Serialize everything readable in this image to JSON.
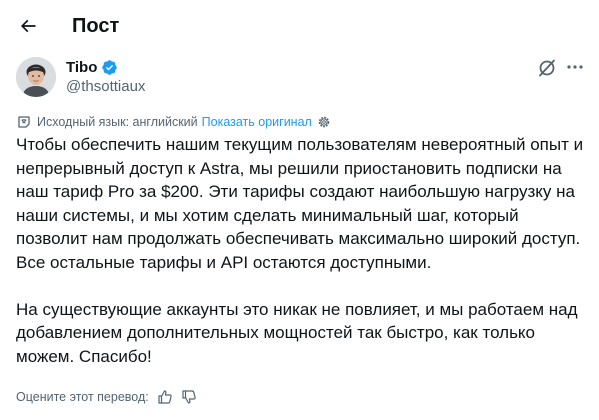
{
  "header": {
    "title": "Пост"
  },
  "author": {
    "name": "Tibo",
    "handle": "@thsottiaux",
    "verified": true
  },
  "translation": {
    "source_label": "Исходный язык: английский",
    "show_original": "Показать оригинал"
  },
  "post": {
    "paragraphs": [
      "Чтобы обеспечить нашим текущим пользователям невероятный опыт и непрерывный доступ к Astra, мы решили приостановить подписки на наш тариф Pro за $200. Эти тарифы создают наибольшую нагрузку на наши системы, и мы хотим сделать минимальный шаг, который позволит нам продолжать обеспечивать максимально широкий доступ. Все остальные тарифы и API остаются доступными.",
      "На существующие аккаунты это никак не повлияет, и мы работаем над добавлением дополнительных мощностей так быстро, как только можем. Спасибо!"
    ]
  },
  "rating": {
    "label": "Оцените этот перевод:"
  },
  "colors": {
    "accent": "#1d9bf0",
    "text": "#0f1419",
    "muted": "#536471"
  }
}
